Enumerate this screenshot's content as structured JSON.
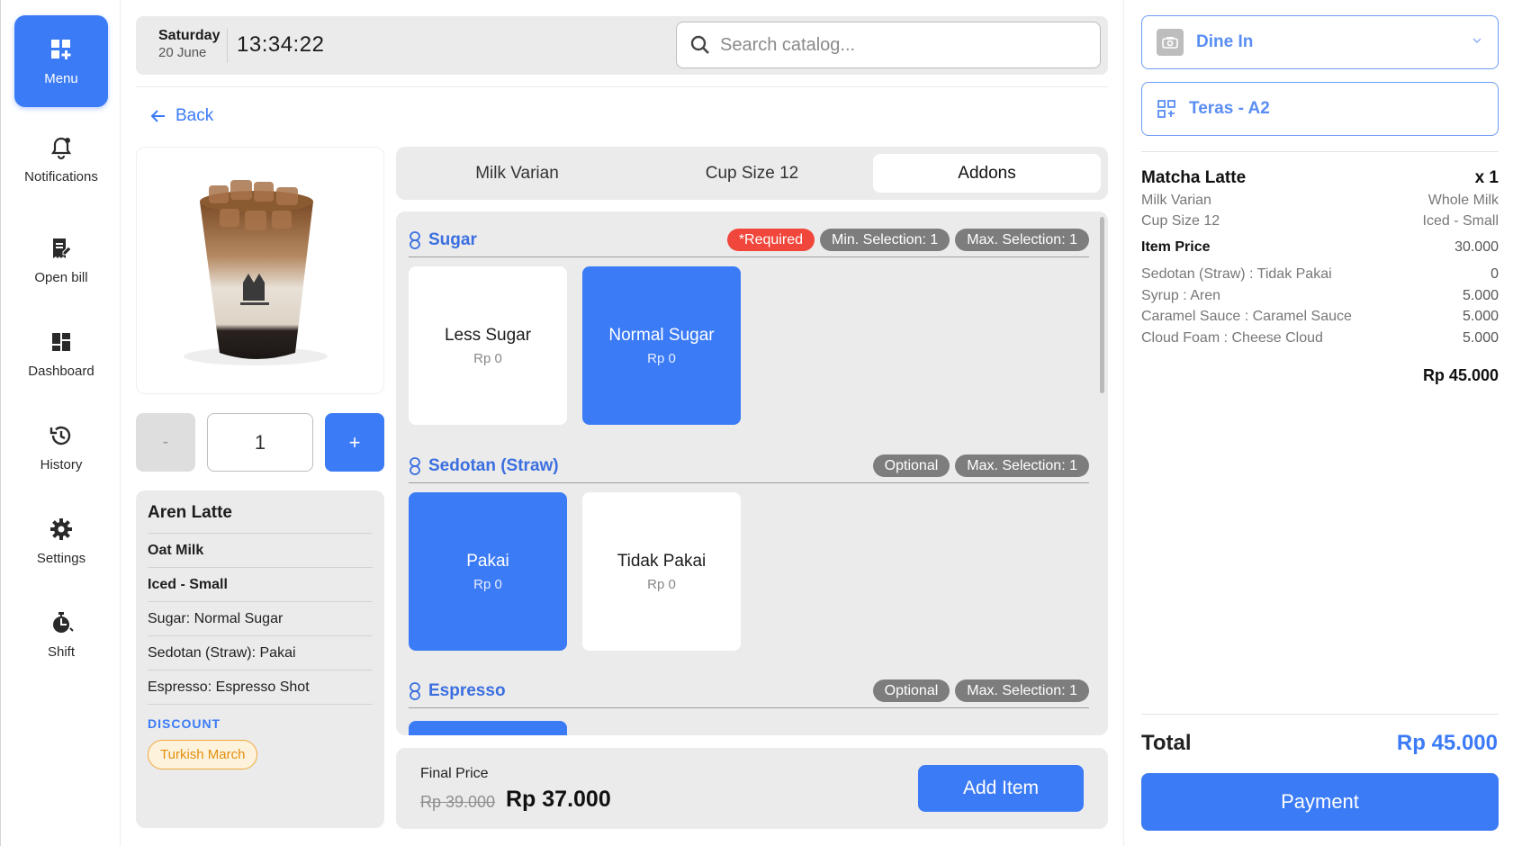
{
  "nav": {
    "items": [
      {
        "label": "Menu",
        "icon": "menu-grid-icon",
        "active": true
      },
      {
        "label": "Notifications",
        "icon": "bell-icon"
      },
      {
        "label": "Open bill",
        "icon": "open-bill-icon"
      },
      {
        "label": "Dashboard",
        "icon": "dashboard-icon"
      },
      {
        "label": "History",
        "icon": "history-icon"
      },
      {
        "label": "Settings",
        "icon": "gear-icon"
      },
      {
        "label": "Shift",
        "icon": "shift-icon"
      }
    ]
  },
  "header": {
    "day": "Saturday",
    "date": "20 June",
    "time": "13:34:22",
    "search_placeholder": "Search catalog..."
  },
  "back_label": "Back",
  "product": {
    "quantity": "1",
    "minus_label": "-",
    "plus_label": "+",
    "name": "Aren Latte",
    "details": [
      "Oat Milk",
      "Iced - Small",
      "Sugar: Normal Sugar",
      "Sedotan (Straw): Pakai",
      "Espresso: Espresso Shot"
    ],
    "discount_label": "DISCOUNT",
    "discount_chip": "Turkish March"
  },
  "tabs": [
    {
      "label": "Milk Varian"
    },
    {
      "label": "Cup Size 12"
    },
    {
      "label": "Addons",
      "active": true
    }
  ],
  "addon_groups": [
    {
      "title": "Sugar",
      "badges": [
        "*Required",
        "Min. Selection: 1",
        "Max. Selection: 1"
      ],
      "options": [
        {
          "name": "Less Sugar",
          "price": "Rp 0",
          "selected": false
        },
        {
          "name": "Normal Sugar",
          "price": "Rp 0",
          "selected": true
        }
      ]
    },
    {
      "title": "Sedotan (Straw)",
      "badges": [
        "Optional",
        "Max. Selection: 1"
      ],
      "options": [
        {
          "name": "Pakai",
          "price": "Rp 0",
          "selected": true
        },
        {
          "name": "Tidak Pakai",
          "price": "Rp 0",
          "selected": false
        }
      ]
    },
    {
      "title": "Espresso",
      "badges": [
        "Optional",
        "Max. Selection: 1"
      ],
      "options": []
    }
  ],
  "footer": {
    "final_price_label": "Final Price",
    "old_price": "Rp 39.000",
    "new_price": "Rp 37.000",
    "add_item_label": "Add Item"
  },
  "order": {
    "service_type": "Dine In",
    "table": "Teras - A2",
    "item_name": "Matcha Latte",
    "item_qty": "x 1",
    "variants": [
      {
        "label": "Milk Varian",
        "value": "Whole Milk"
      },
      {
        "label": "Cup Size 12",
        "value": "Iced - Small"
      }
    ],
    "item_price_label": "Item Price",
    "item_price": "30.000",
    "addons": [
      {
        "label": "Sedotan (Straw) : Tidak Pakai",
        "value": "0"
      },
      {
        "label": "Syrup : Aren",
        "value": "5.000"
      },
      {
        "label": "Caramel Sauce : Caramel Sauce",
        "value": "5.000"
      },
      {
        "label": "Cloud Foam : Cheese Cloud",
        "value": "5.000"
      }
    ],
    "subtotal": "Rp 45.000",
    "total_label": "Total",
    "total": "Rp 45.000",
    "payment_label": "Payment"
  },
  "colors": {
    "accent": "#3b7bf6",
    "required": "#f1463b",
    "discount": "#f2a63a"
  }
}
